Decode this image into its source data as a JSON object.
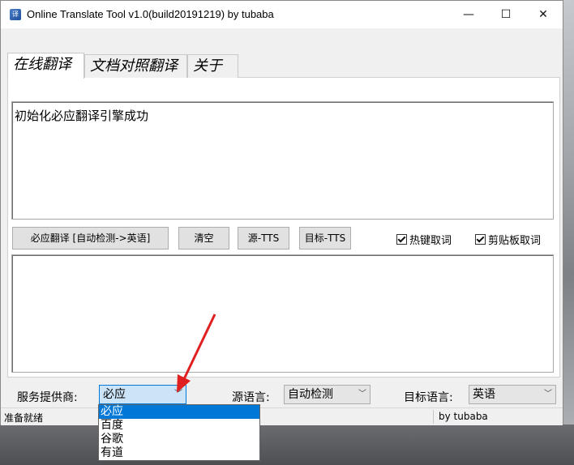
{
  "window": {
    "title": "Online Translate Tool v1.0(build20191219) by tubaba",
    "app_icon_glyph": "译",
    "controls": {
      "minimize": "—",
      "maximize": "☐",
      "close": "✕"
    }
  },
  "tabs": [
    {
      "label": "在线翻译",
      "active": true
    },
    {
      "label": "文档对照翻译",
      "active": false
    },
    {
      "label": "关于",
      "active": false
    }
  ],
  "source_text": "初始化必应翻译引擎成功",
  "output_text": "",
  "toolbar": {
    "translate_label": "必应翻译 [自动检测->英语]",
    "clear_label": "清空",
    "source_tts_label": "源-TTS",
    "target_tts_label": "目标-TTS",
    "hotkey_checkbox": {
      "label": "热键取词",
      "checked": true
    },
    "clipboard_checkbox": {
      "label": "剪贴板取词",
      "checked": true
    }
  },
  "bottom": {
    "provider_label": "服务提供商:",
    "provider_value": "必应",
    "source_lang_label": "源语言:",
    "source_lang_value": "自动检测",
    "target_lang_label": "目标语言:",
    "target_lang_value": "英语"
  },
  "provider_dropdown": {
    "options": [
      "必应",
      "百度",
      "谷歌",
      "有道"
    ],
    "selected_index": 0
  },
  "status": {
    "left": "准备就绪",
    "right": "by tubaba"
  },
  "colors": {
    "selection": "#0078d7",
    "annotation_arrow": "#e02020"
  }
}
